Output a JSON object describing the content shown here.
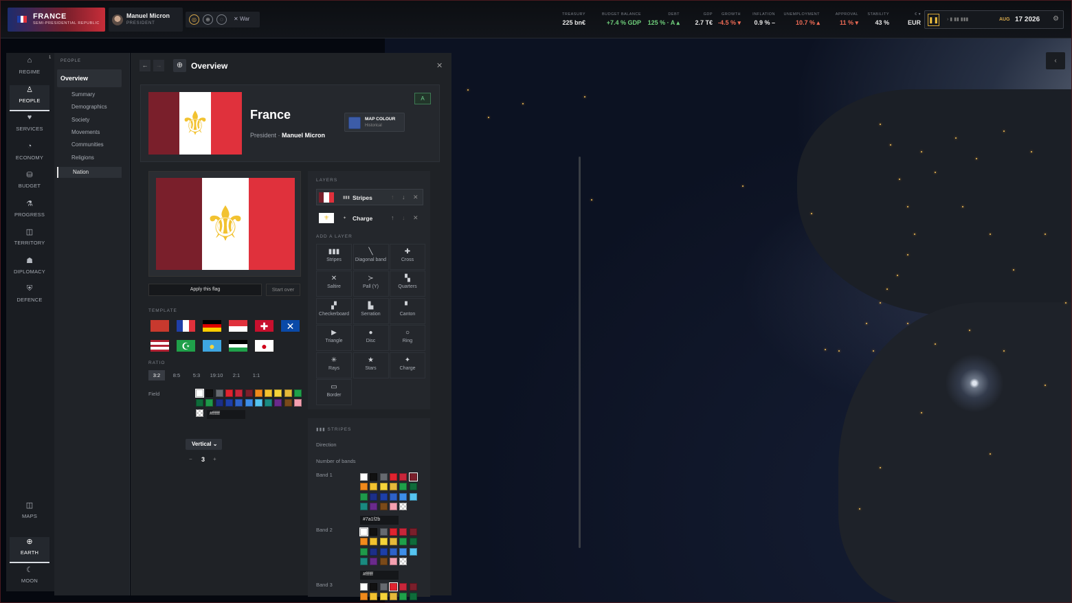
{
  "country": {
    "name": "FRANCE",
    "subtitle": "SEMI-PRESIDENTIAL REPUBLIC",
    "flag_colors": [
      "#1f3fa8",
      "#ffffff",
      "#e0313c"
    ]
  },
  "leader": {
    "name": "Manuel Micron",
    "title": "PRESIDENT"
  },
  "actions": {
    "war_label": "War"
  },
  "stats": [
    {
      "label": "TREASURY",
      "value": "225 bn€",
      "tone": "plain"
    },
    {
      "label": "BUDGET BALANCE",
      "value": "+7.4 % GDP",
      "tone": "pos"
    },
    {
      "label": "DEBT",
      "value": "125 % · A ▴",
      "tone": "pos"
    },
    {
      "label": "GDP",
      "value": "2.7 T€",
      "tone": "plain"
    },
    {
      "label": "GROWTH",
      "value": "-4.5 % ▾",
      "tone": "neg"
    },
    {
      "label": "INFLATION",
      "value": "0.9 % –",
      "tone": "plain"
    },
    {
      "label": "UNEMPLOYMENT",
      "value": "10.7 % ▴",
      "tone": "neg"
    },
    {
      "label": "APPROVAL",
      "value": "11 % ▾",
      "tone": "neg"
    },
    {
      "label": "STABILITY",
      "value": "43 %",
      "tone": "plain"
    },
    {
      "label": "€ ▾",
      "value": "EUR",
      "tone": "plain"
    }
  ],
  "date": {
    "month": "AUG",
    "day_year": "17 2026"
  },
  "sidebar": {
    "items": [
      {
        "label": "REGIME",
        "icon": "⌂"
      },
      {
        "label": "PEOPLE",
        "icon": "♙"
      },
      {
        "label": "SERVICES",
        "icon": "♥"
      },
      {
        "label": "ECONOMY",
        "icon": "◔"
      },
      {
        "label": "BUDGET",
        "icon": "⛁"
      },
      {
        "label": "PROGRESS",
        "icon": "⚗"
      },
      {
        "label": "TERRITORY",
        "icon": "◫"
      },
      {
        "label": "DIPLOMACY",
        "icon": "☗"
      },
      {
        "label": "DEFENCE",
        "icon": "⛨"
      }
    ],
    "bottom": [
      {
        "label": "MAPS",
        "icon": "◫"
      },
      {
        "label": "EARTH",
        "icon": "⊕"
      },
      {
        "label": "MOON",
        "icon": "☾"
      }
    ],
    "badge": "1"
  },
  "subnav": {
    "header": "PEOPLE",
    "selected": "Overview",
    "items": [
      "Summary",
      "Demographics",
      "Society",
      "Movements",
      "Communities",
      "Religions",
      "Nation"
    ]
  },
  "panel": {
    "title": "Overview",
    "country_name": "France",
    "president_label": "President · ",
    "president_name": "Manuel Micron",
    "map_colour_label": "MAP COLOUR",
    "map_colour_sub": "Historical",
    "badge": "A",
    "apply_label": "Apply this flag",
    "start_over": "Start over",
    "template_label": "TEMPLATE",
    "ratio_label": "RATIO",
    "ratios": [
      "3:2",
      "8:5",
      "5:3",
      "19:10",
      "2:1",
      "1:1"
    ],
    "field_label": "Field",
    "field_hex": "#ffffff"
  },
  "flag": {
    "bands": [
      "#7a1f2b",
      "#ffffff",
      "#e0313c"
    ],
    "charge": "⚜",
    "charge_color": "#f2c230"
  },
  "layers": {
    "header": "LAYERS",
    "items": [
      {
        "name": "Stripes",
        "icon": "▮▮▮"
      },
      {
        "name": "Charge",
        "icon": "✦"
      }
    ],
    "add_header": "ADD A LAYER",
    "add_items": [
      {
        "label": "Stripes",
        "icon": "▮▮▮"
      },
      {
        "label": "Diagonal band",
        "icon": "╲"
      },
      {
        "label": "Cross",
        "icon": "✚"
      },
      {
        "label": "Saltire",
        "icon": "✕"
      },
      {
        "label": "Pall (Y)",
        "icon": "≻"
      },
      {
        "label": "Quarters",
        "icon": "▚"
      },
      {
        "label": "Checkerboard",
        "icon": "▞"
      },
      {
        "label": "Serration",
        "icon": "▙"
      },
      {
        "label": "Canton",
        "icon": "▘"
      },
      {
        "label": "Triangle",
        "icon": "▶"
      },
      {
        "label": "Disc",
        "icon": "●"
      },
      {
        "label": "Ring",
        "icon": "○"
      },
      {
        "label": "Rays",
        "icon": "✳"
      },
      {
        "label": "Stars",
        "icon": "★"
      },
      {
        "label": "Charge",
        "icon": "✦"
      },
      {
        "label": "Border",
        "icon": "▭"
      }
    ]
  },
  "stripes": {
    "header": "STRIPES",
    "direction_label": "Direction",
    "direction_value": "Vertical",
    "bands_label": "Number of bands",
    "bands_value": "3",
    "band_labels": [
      "Band 1",
      "Band 2",
      "Band 3"
    ],
    "band_hex": [
      "#7a1f2b",
      "#ffffff"
    ]
  },
  "palette": [
    "#ffffff",
    "#111111",
    "#666a70",
    "#e0232f",
    "#c7263a",
    "#7a1f2b",
    "#f08a1c",
    "#f2c230",
    "#f5d43a",
    "#e5b93a",
    "#1fa04a",
    "#0f6b3a",
    "#1f9a4a",
    "#1c2f88",
    "#1d3fa8",
    "#2e62c8",
    "#3e8ee8",
    "#56c4f0",
    "#1a8a80",
    "#6a2a8c",
    "#7a4a1a",
    "#f5a0b0",
    "checker"
  ],
  "field_palette": [
    "#ffffff",
    "#111111",
    "#666a70",
    "#e0232f",
    "#c7263a",
    "#7a1f2b",
    "#f08a1c",
    "#f2c230",
    "#f5d43a",
    "#e5b93a",
    "#1fa04a",
    "#0f6b3a",
    "#1f9a4a",
    "#1c2f88",
    "#1d3fa8",
    "#2e62c8",
    "#3e8ee8",
    "#56c4f0",
    "#1a8a80",
    "#6a2a8c",
    "#7a4a1a",
    "#f5a0b0",
    "checker"
  ],
  "templates": [
    {
      "name": "red",
      "colors": [
        "#c8392e"
      ]
    },
    {
      "name": "france",
      "colors": [
        "#1f3fa8",
        "#ffffff",
        "#e0313c"
      ]
    },
    {
      "name": "germany",
      "colors": [
        "#000000",
        "#dd0000",
        "#ffce00"
      ],
      "dir": "h"
    },
    {
      "name": "indonesia",
      "colors": [
        "#e0313c",
        "#ffffff"
      ],
      "dir": "h"
    },
    {
      "name": "denmark",
      "colors": [
        "#c8102e"
      ],
      "mark": "✚"
    },
    {
      "name": "scotland",
      "colors": [
        "#0a4aa8"
      ],
      "mark": "✕"
    },
    {
      "name": "usa",
      "colors": [
        "#b22234",
        "#ffffff",
        "#b22234",
        "#ffffff",
        "#b22234"
      ],
      "dir": "h"
    },
    {
      "name": "pakistan",
      "colors": [
        "#1fa04a"
      ],
      "mark": "☪"
    },
    {
      "name": "kazakhstan",
      "colors": [
        "#3ea5e0"
      ],
      "mark": "●"
    },
    {
      "name": "palestine",
      "colors": [
        "#000000",
        "#ffffff",
        "#1fa04a"
      ],
      "dir": "h"
    },
    {
      "name": "japan",
      "colors": [
        "#ffffff"
      ],
      "mark": "●"
    }
  ]
}
